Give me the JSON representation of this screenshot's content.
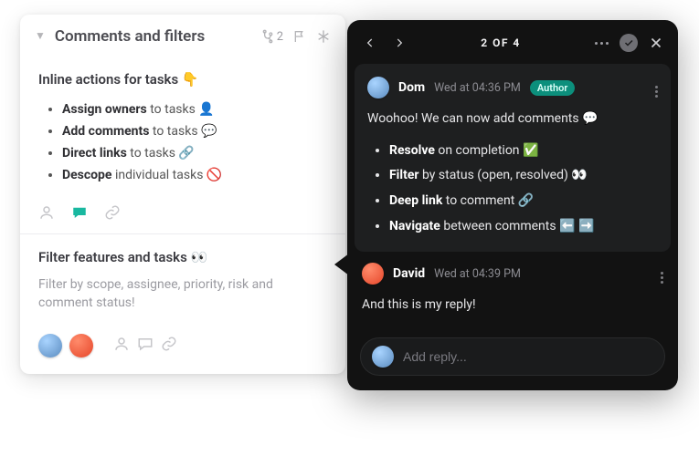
{
  "left": {
    "title": "Comments and filters",
    "branch_count": "2",
    "section1": {
      "heading": "Inline actions for tasks 👇",
      "items": [
        {
          "b": "Assign owners",
          "rest": " to tasks 👤"
        },
        {
          "b": "Add comments",
          "rest": " to tasks 💬"
        },
        {
          "b": "Direct links",
          "rest": " to tasks 🔗"
        },
        {
          "b": "Descope",
          "rest": " individual tasks 🚫"
        }
      ]
    },
    "section2": {
      "heading": "Filter features and tasks 👀",
      "sub": "Filter by scope, assignee, priority, risk and comment status!"
    }
  },
  "right": {
    "counter": "2 OF 4",
    "comment1": {
      "author": "Dom",
      "time": "Wed at 04:36 PM",
      "badge": "Author",
      "body_intro": "Woohoo! We can now add comments 💬",
      "items": [
        {
          "b": "Resolve",
          "rest": " on completion ✅"
        },
        {
          "b": "Filter",
          "rest": " by status (open, resolved) 👀"
        },
        {
          "b": "Deep link",
          "rest": " to comment 🔗"
        },
        {
          "b": "Navigate",
          "rest": " between comments ⬅️ ➡️"
        }
      ]
    },
    "comment2": {
      "author": "David",
      "time": "Wed at 04:39 PM",
      "body": "And this is my reply!"
    },
    "reply_placeholder": "Add reply..."
  }
}
